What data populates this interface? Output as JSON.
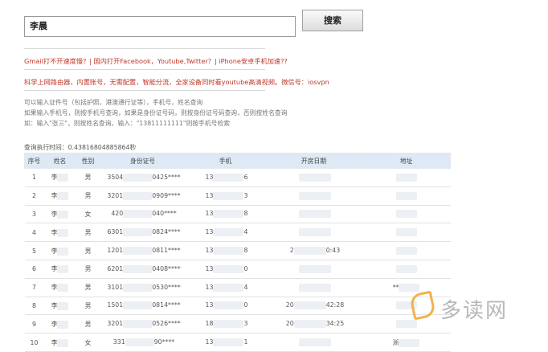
{
  "search": {
    "value": "李晨",
    "button_label": "搜索"
  },
  "promo_lines": [
    "Gmail打不开速度慢？| 国内打开Facebook，Youtube,Twitter？| iPhone安卓手机加速??",
    "科学上网路由器，内置账号，无需配置，智能分流，全家设备同时看youtube高清视频。微信号：iosvpn"
  ],
  "notes": [
    "可以输入证件号（包括护照，港澳通行证等），手机号，姓名查询",
    "如果输入手机号，则按手机号查询，如果是身份证号码，则按身份证号码查询，否则按姓名查询",
    "如：输入\"张三\"，则按姓名查询，输入：\"13811111111\"则按手机号检索"
  ],
  "query_time": "查询执行时间：0.43816804885864秒",
  "table": {
    "headers": [
      "序号",
      "姓名",
      "性别",
      "身份证号",
      "手机",
      "开房日期",
      "地址"
    ],
    "rows": [
      {
        "no": "1",
        "name": "李",
        "gender": "男",
        "id_start": "3504",
        "id_end": "0425****",
        "phone_start": "13",
        "phone_end": "6",
        "date_start": "",
        "date_end": "",
        "addr": ""
      },
      {
        "no": "2",
        "name": "李",
        "gender": "男",
        "id_start": "3201",
        "id_end": "0909****",
        "phone_start": "13",
        "phone_end": "3",
        "date_start": "",
        "date_end": "",
        "addr": ""
      },
      {
        "no": "3",
        "name": "李",
        "gender": "女",
        "id_start": "420",
        "id_end": "040****",
        "phone_start": "13",
        "phone_end": "8",
        "date_start": "",
        "date_end": "",
        "addr": ""
      },
      {
        "no": "4",
        "name": "李",
        "gender": "男",
        "id_start": "6301",
        "id_end": "0824****",
        "phone_start": "13",
        "phone_end": "4",
        "date_start": "",
        "date_end": "",
        "addr": ""
      },
      {
        "no": "5",
        "name": "李",
        "gender": "男",
        "id_start": "1201",
        "id_end": "0811****",
        "phone_start": "13",
        "phone_end": "8",
        "date_start": "2",
        "date_end": "0:43",
        "addr": ""
      },
      {
        "no": "6",
        "name": "李",
        "gender": "男",
        "id_start": "6201",
        "id_end": "0408****",
        "phone_start": "13",
        "phone_end": "0",
        "date_start": "",
        "date_end": "",
        "addr": ""
      },
      {
        "no": "7",
        "name": "李",
        "gender": "男",
        "id_start": "3101",
        "id_end": "0530****",
        "phone_start": "13",
        "phone_end": "4",
        "date_start": "",
        "date_end": "",
        "addr": "**"
      },
      {
        "no": "8",
        "name": "李",
        "gender": "男",
        "id_start": "1501",
        "id_end": "0814****",
        "phone_start": "13",
        "phone_end": "0",
        "date_start": "20",
        "date_end": "42:28",
        "addr": ""
      },
      {
        "no": "9",
        "name": "李",
        "gender": "男",
        "id_start": "3201",
        "id_end": "0526****",
        "phone_start": "18",
        "phone_end": "3",
        "date_start": "20",
        "date_end": "34:25",
        "addr": ""
      },
      {
        "no": "10",
        "name": "李",
        "gender": "女",
        "id_start": "331",
        "id_end": "90****",
        "phone_start": "13",
        "phone_end": "1",
        "date_start": "",
        "date_end": "",
        "addr": "浙"
      }
    ]
  },
  "watermark": {
    "text": "多读网",
    "mark_color": "#f0b24a"
  }
}
